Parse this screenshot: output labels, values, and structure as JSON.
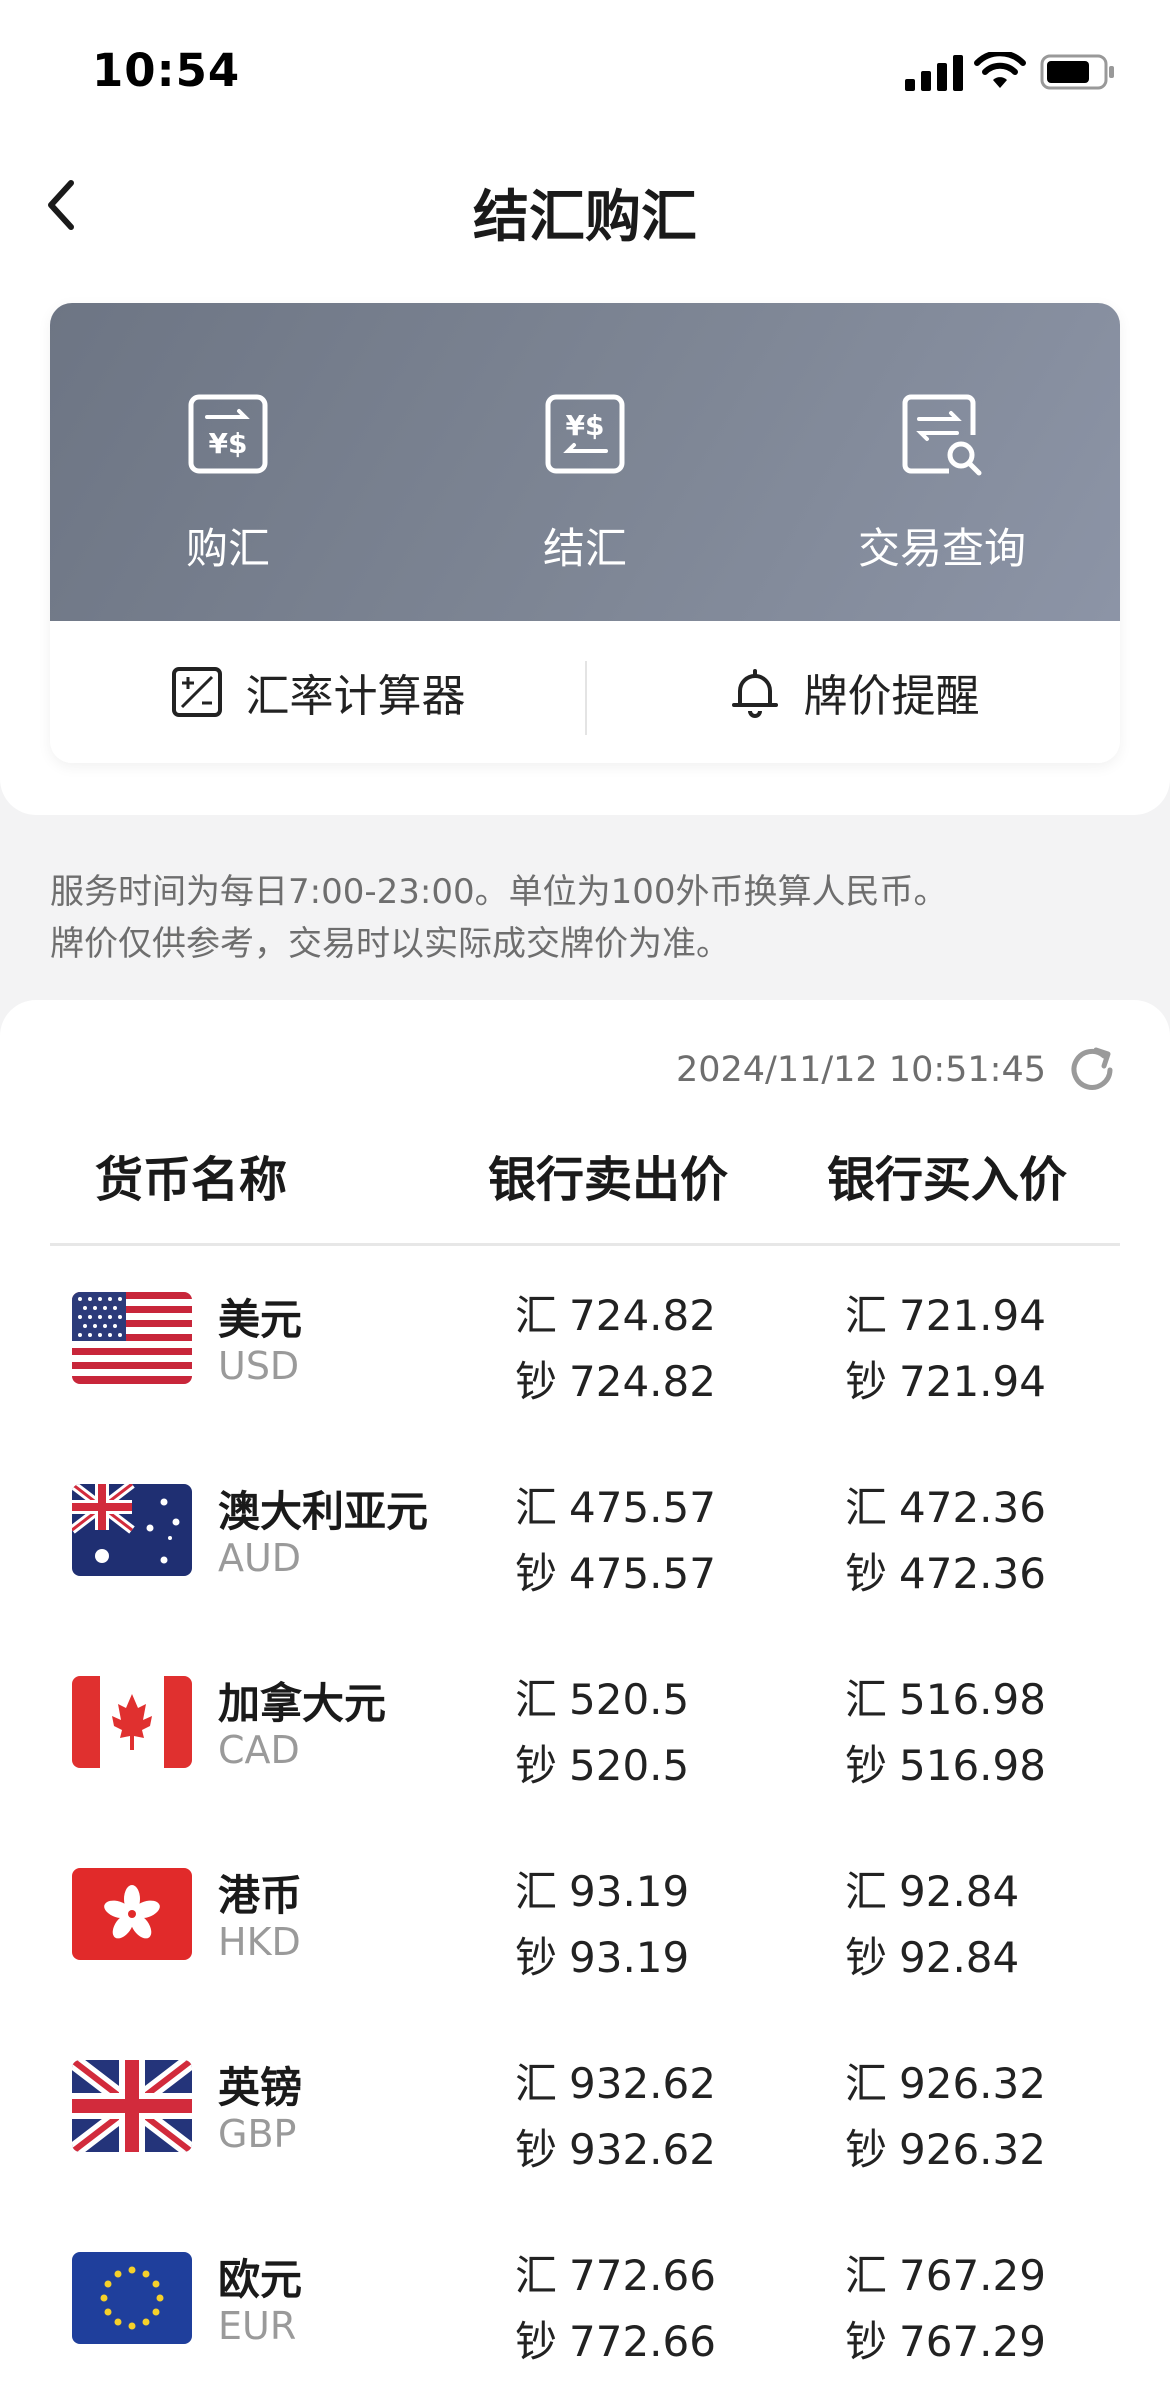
{
  "status_bar": {
    "time": "10:54"
  },
  "nav": {
    "title": "结汇购汇"
  },
  "features": [
    {
      "label": "购汇",
      "icon": "buy-exchange-icon"
    },
    {
      "label": "结汇",
      "icon": "settle-exchange-icon"
    },
    {
      "label": "交易查询",
      "icon": "transaction-query-icon"
    }
  ],
  "tools": [
    {
      "label": "汇率计算器",
      "icon": "calculator-icon"
    },
    {
      "label": "牌价提醒",
      "icon": "bell-icon"
    }
  ],
  "notice": {
    "line1": "服务时间为每日7:00-23:00。单位为100外币换算人民币。",
    "line2": "牌价仅供参考，交易时以实际成交牌价为准。"
  },
  "rates": {
    "timestamp": "2024/11/12 10:51:45",
    "headers": {
      "currency": "货币名称",
      "sell": "银行卖出价",
      "buy": "银行买入价"
    },
    "tags": {
      "remit": "汇",
      "cash": "钞"
    },
    "rows": [
      {
        "name": "美元",
        "code": "USD",
        "flag": "us-flag-icon",
        "sell_remit": "724.82",
        "sell_cash": "724.82",
        "buy_remit": "721.94",
        "buy_cash": "721.94"
      },
      {
        "name": "澳大利亚元",
        "code": "AUD",
        "flag": "au-flag-icon",
        "sell_remit": "475.57",
        "sell_cash": "475.57",
        "buy_remit": "472.36",
        "buy_cash": "472.36"
      },
      {
        "name": "加拿大元",
        "code": "CAD",
        "flag": "ca-flag-icon",
        "sell_remit": "520.5",
        "sell_cash": "520.5",
        "buy_remit": "516.98",
        "buy_cash": "516.98"
      },
      {
        "name": "港币",
        "code": "HKD",
        "flag": "hk-flag-icon",
        "sell_remit": "93.19",
        "sell_cash": "93.19",
        "buy_remit": "92.84",
        "buy_cash": "92.84"
      },
      {
        "name": "英镑",
        "code": "GBP",
        "flag": "gb-flag-icon",
        "sell_remit": "932.62",
        "sell_cash": "932.62",
        "buy_remit": "926.32",
        "buy_cash": "926.32"
      },
      {
        "name": "欧元",
        "code": "EUR",
        "flag": "eu-flag-icon",
        "sell_remit": "772.66",
        "sell_cash": "772.66",
        "buy_remit": "767.29",
        "buy_cash": "767.29"
      }
    ]
  }
}
